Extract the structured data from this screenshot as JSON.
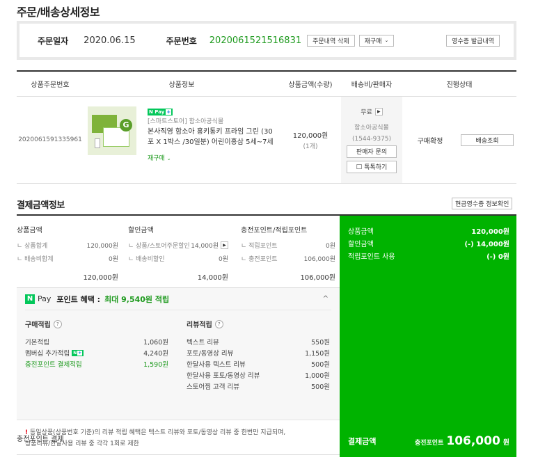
{
  "page_title": "주문/배송상세정보",
  "order": {
    "date_label": "주문일자",
    "date": "2020.06.15",
    "number_label": "주문번호",
    "number": "2020061521516831",
    "delete_btn": "주문내역 삭제",
    "reorder_btn": "재구매",
    "receipt_btn": "영수증 발급내역"
  },
  "product_table": {
    "headers": [
      "상품주문번호",
      "상품정보",
      "상품금액(수량)",
      "배송비/판매자",
      "진행상태"
    ],
    "row": {
      "product_order_no": "2020061591335961",
      "npay_badge": "Pay",
      "store": "[스마트스토어] 함소아공식몰",
      "name": "본사직영 함소아 홍키통키 프라임 그린 (30포 X 1박스 /30일분) 어린이홍삼 5세~7세",
      "reorder": "재구매",
      "price": "120,000원",
      "qty": "(1개)",
      "shipping": "무료",
      "seller": "함소아공식몰",
      "phone": "(1544-9375)",
      "seller_inquiry_btn": "판매자 문의",
      "talk_btn": "톡톡하기",
      "status": "구매확정",
      "track_btn": "배송조회"
    }
  },
  "payment": {
    "title": "결제금액정보",
    "cash_receipt_btn": "현금영수증 정보확인",
    "product_amount": {
      "title": "상품금액",
      "rows": [
        {
          "name": "상품합계",
          "value": "120,000원"
        },
        {
          "name": "배송비합계",
          "value": "0원"
        }
      ],
      "total": "120,000원"
    },
    "discount": {
      "title": "할인금액",
      "rows": [
        {
          "name": "상품/스토어주문할인",
          "value": "14,000원"
        },
        {
          "name": "배송비할인",
          "value": "0원"
        }
      ],
      "total": "14,000원"
    },
    "points": {
      "title": "충전포인트/적립포인트",
      "rows": [
        {
          "name": "적립포인트",
          "value": "0원"
        },
        {
          "name": "충전포인트",
          "value": "106,000원"
        }
      ],
      "total": "106,000원"
    },
    "npay": {
      "logo": "N",
      "pay": "Pay",
      "benefit": "포인트 혜택 :",
      "max": "최대 9,540원 적립",
      "caret": "^",
      "purchase": {
        "title": "구매적립",
        "rows": [
          {
            "name": "기본적립",
            "value": "1,060원"
          },
          {
            "name": "멤버십 추가적립",
            "value": "4,240원"
          },
          {
            "name": "충전포인트 결제적립",
            "value": "1,590원"
          }
        ]
      },
      "review": {
        "title": "리뷰적립",
        "rows": [
          {
            "name": "텍스트 리뷰",
            "value": "550원"
          },
          {
            "name": "포토/동영상 리뷰",
            "value": "1,150원"
          },
          {
            "name": "한달사용 텍스트 리뷰",
            "value": "500원"
          },
          {
            "name": "한달사용 포토/동영상 리뷰",
            "value": "1,000원"
          },
          {
            "name": "스토어찜 고객 리뷰",
            "value": "500원"
          }
        ]
      }
    },
    "notice_line1": "동일상품(상품번호 기준)의 리뷰 적립 혜택은 텍스트 리뷰와 포토/동영상 리뷰 중 한번만 지급되며,",
    "notice_line2": "상품리뷰/한달사용 리뷰 중 각각 1회로 제한",
    "charge_payment": "충전포인트 결제",
    "summary": {
      "rows": [
        {
          "name": "상품금액",
          "value": "120,000원"
        },
        {
          "name": "할인금액",
          "value": "(-) 14,000원"
        },
        {
          "name": "적립포인트 사용",
          "value": "(-) 0원"
        }
      ],
      "final_label": "결제금액",
      "final_sub": "충전포인트",
      "final_amount": "106,000",
      "final_unit": "원"
    },
    "colors": {
      "accent_green": "#00b300",
      "text_green": "#1e9a1e",
      "npay_green": "#03c75a"
    }
  }
}
